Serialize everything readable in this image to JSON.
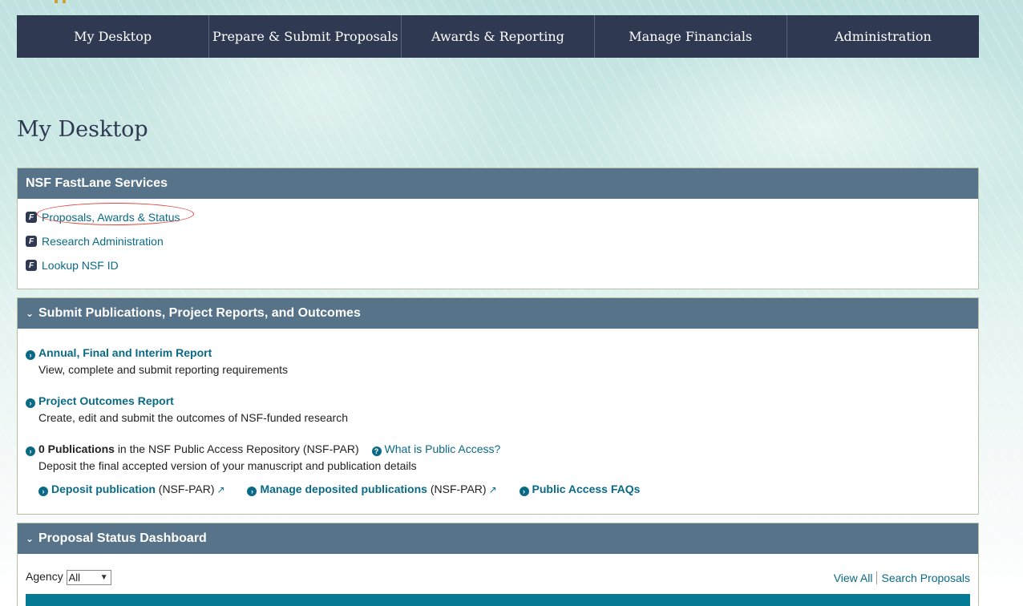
{
  "nav": {
    "items": [
      "My Desktop",
      "Prepare & Submit Proposals",
      "Awards & Reporting",
      "Manage Financials",
      "Administration"
    ]
  },
  "page_title": "My Desktop",
  "fastlane": {
    "header": "NSF FastLane Services",
    "icon_letter": "F",
    "items": [
      "Proposals, Awards & Status",
      "Research Administration",
      "Lookup NSF ID"
    ]
  },
  "publications": {
    "header": "Submit Publications, Project Reports, and Outcomes",
    "annual": {
      "title": "Annual, Final and Interim Report",
      "desc": "View, complete and submit reporting requirements"
    },
    "outcomes": {
      "title": "Project Outcomes Report",
      "desc": "Create, edit and submit the outcomes of NSF-funded research"
    },
    "par": {
      "count_label": "0 Publications",
      "suffix": "in the NSF Public Access Repository (NSF-PAR)",
      "what_link": "What is Public Access?",
      "desc": "Deposit the final accepted version of your manuscript and publication details",
      "deposit_label": "Deposit publication",
      "deposit_suffix": "(NSF-PAR)",
      "manage_label": "Manage deposited publications",
      "manage_suffix": "(NSF-PAR)",
      "faq_label": "Public Access FAQs"
    }
  },
  "dashboard": {
    "header": "Proposal Status Dashboard",
    "agency_label": "Agency",
    "agency_value": "All",
    "view_all": "View All",
    "search_proposals": "Search Proposals"
  },
  "icons": {
    "chevron": "chevron-down-icon",
    "arrow": "circle-arrow-icon",
    "question": "question-circle-icon",
    "external": "external-link-icon"
  },
  "colors": {
    "nav_bg": "#2f3a52",
    "panel_header": "#567389",
    "link": "#0a6a86",
    "highlight_oval": "#e0443a",
    "table_header": "#047a94"
  }
}
